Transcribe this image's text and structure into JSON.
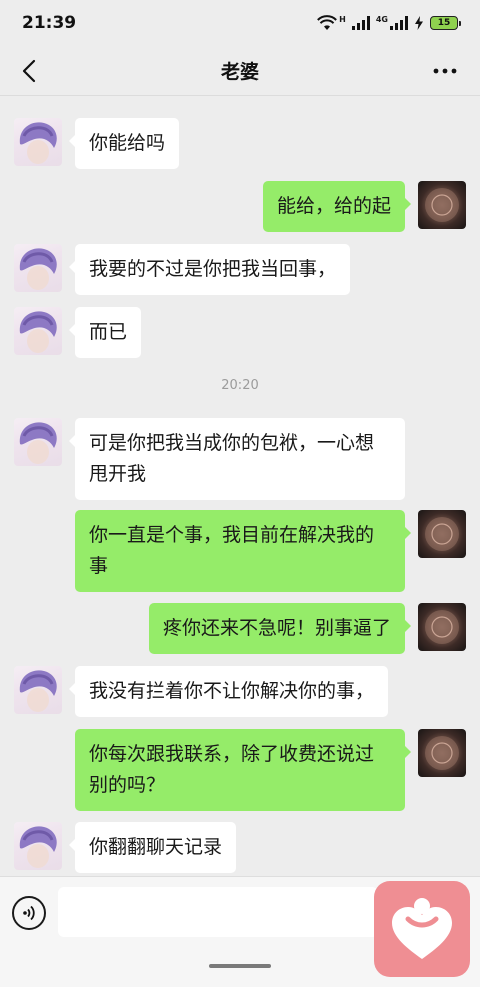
{
  "status_bar": {
    "time": "21:39",
    "wifi_label": "H",
    "network_label": "4G",
    "battery": "15"
  },
  "header": {
    "title": "老婆",
    "back_icon": "chevron-left-icon",
    "more_icon": "more-dots-icon"
  },
  "messages": [
    {
      "side": "left",
      "text": "你能给吗"
    },
    {
      "side": "right",
      "text": "能给，给的起"
    },
    {
      "side": "left",
      "text": "我要的不过是你把我当回事，"
    },
    {
      "side": "left",
      "text": "而已"
    },
    {
      "side": "left",
      "text": "可是你把我当成你的包袱，一心想甩开我"
    },
    {
      "side": "right",
      "text": "你一直是个事，我目前在解决我的事"
    },
    {
      "side": "right",
      "text": "疼你还来不急呢！别事逼了"
    },
    {
      "side": "left",
      "text": "我没有拦着你不让你解决你的事，"
    },
    {
      "side": "right",
      "text": "你每次跟我联系，除了收费还说过别的吗？"
    },
    {
      "side": "left",
      "text": "你翻翻聊天记录"
    }
  ],
  "timestamp": "20:20",
  "input_bar": {
    "voice_icon": "voice-icon",
    "input_value": ""
  },
  "colors": {
    "background": "#ededed",
    "bubble_sent": "#95ec69",
    "bubble_received": "#ffffff",
    "app_badge": "#ef8e93"
  }
}
